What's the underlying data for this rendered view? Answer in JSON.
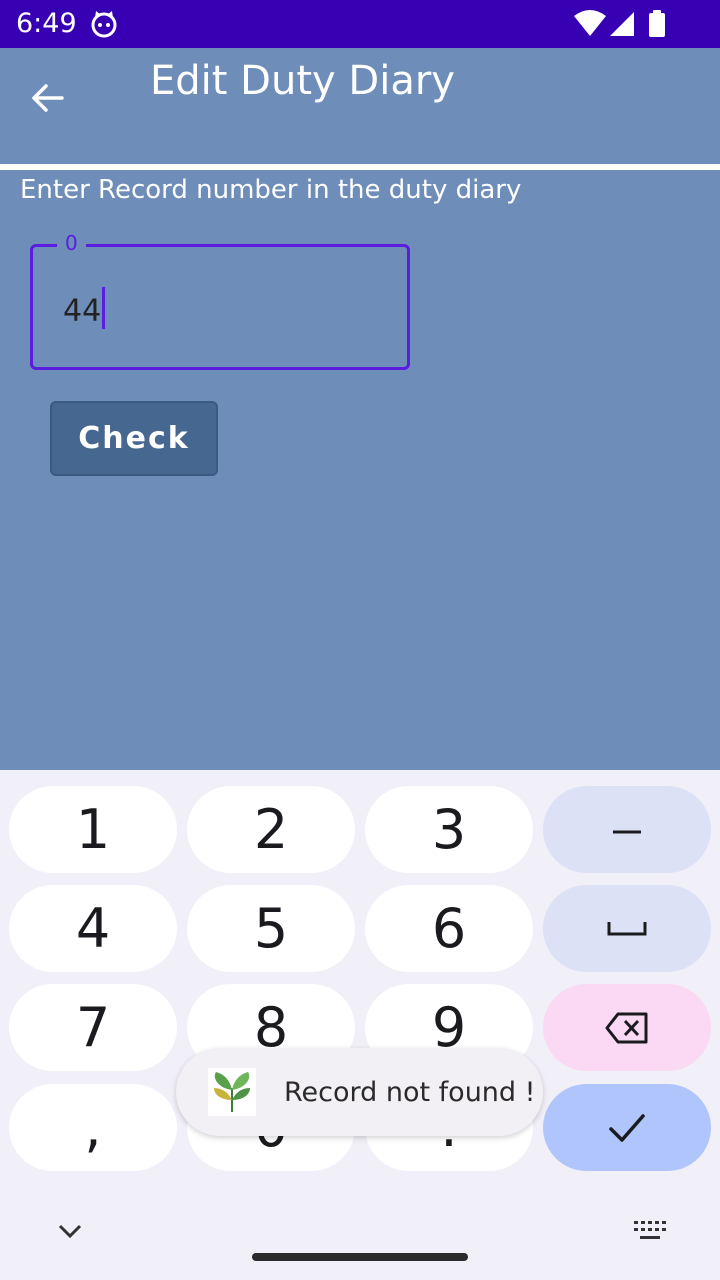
{
  "status_bar": {
    "time": "6:49",
    "icons": [
      "cat-icon",
      "wifi-icon",
      "signal-icon",
      "battery-icon"
    ]
  },
  "app_bar": {
    "title": "Edit Duty Diary",
    "back_icon": "arrow-back-icon"
  },
  "form": {
    "instruction": "Enter Record number in the duty diary",
    "record_field": {
      "label": "0",
      "value": "44"
    },
    "check_label": "Check"
  },
  "keyboard": {
    "keys": [
      [
        "1",
        "2",
        "3",
        "–"
      ],
      [
        "4",
        "5",
        "6",
        "␣"
      ],
      [
        "7",
        "8",
        "9",
        "backspace"
      ],
      [
        ",",
        "0",
        ".",
        "done"
      ]
    ],
    "collapse_icon": "chevron-down-icon",
    "switch_icon": "keyboard-icon"
  },
  "toast": {
    "message": "Record not found !",
    "icon": "plant-leaves-icon"
  },
  "colors": {
    "status_bar": "#3700b3",
    "app_background": "#6e8db8",
    "accent": "#5b1ee0",
    "button": "#46678f"
  }
}
